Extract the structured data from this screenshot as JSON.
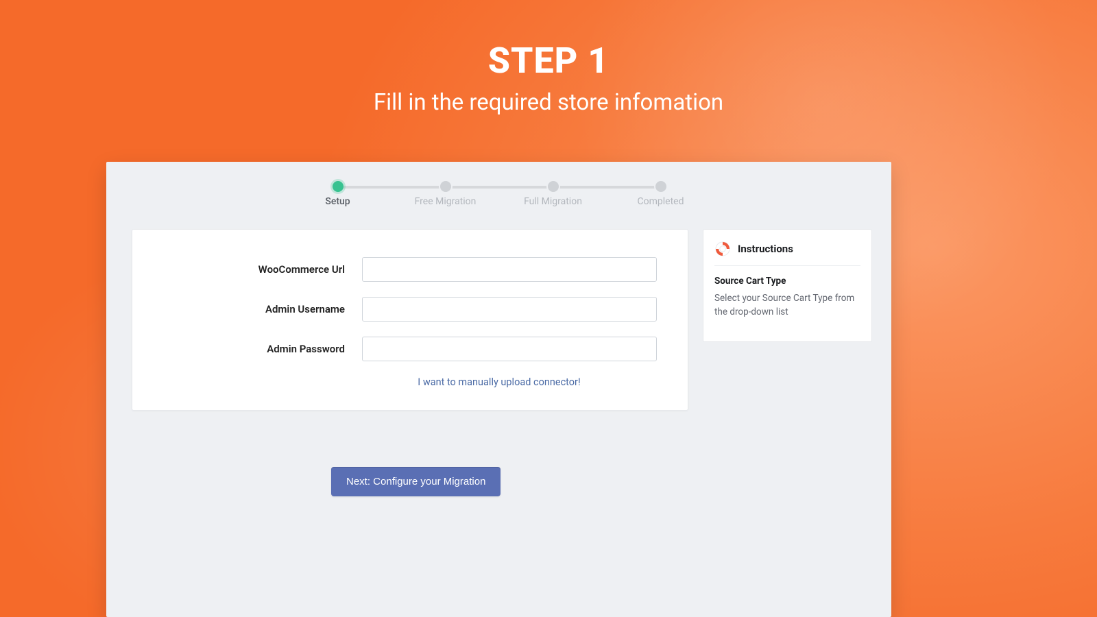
{
  "header": {
    "title": "STEP 1",
    "subtitle": "Fill in the required store infomation"
  },
  "stepper": {
    "steps": [
      {
        "label": "Setup",
        "active": true
      },
      {
        "label": "Free Migration",
        "active": false
      },
      {
        "label": "Full Migration",
        "active": false
      },
      {
        "label": "Completed",
        "active": false
      }
    ]
  },
  "form": {
    "url_label": "WooCommerce Url",
    "url_value": "",
    "user_label": "Admin Username",
    "user_value": "",
    "pass_label": "Admin Password",
    "pass_value": "",
    "manual_link": "I want to manually upload connector!"
  },
  "instructions": {
    "heading": "Instructions",
    "subtitle": "Source Cart Type",
    "body": "Select your Source Cart Type from the drop-down list"
  },
  "actions": {
    "next_label": "Next: Configure your Migration"
  },
  "colors": {
    "accent_orange": "#f56a2a",
    "step_active": "#37c290",
    "button": "#5a6fb4",
    "link": "#4a6aa5"
  }
}
